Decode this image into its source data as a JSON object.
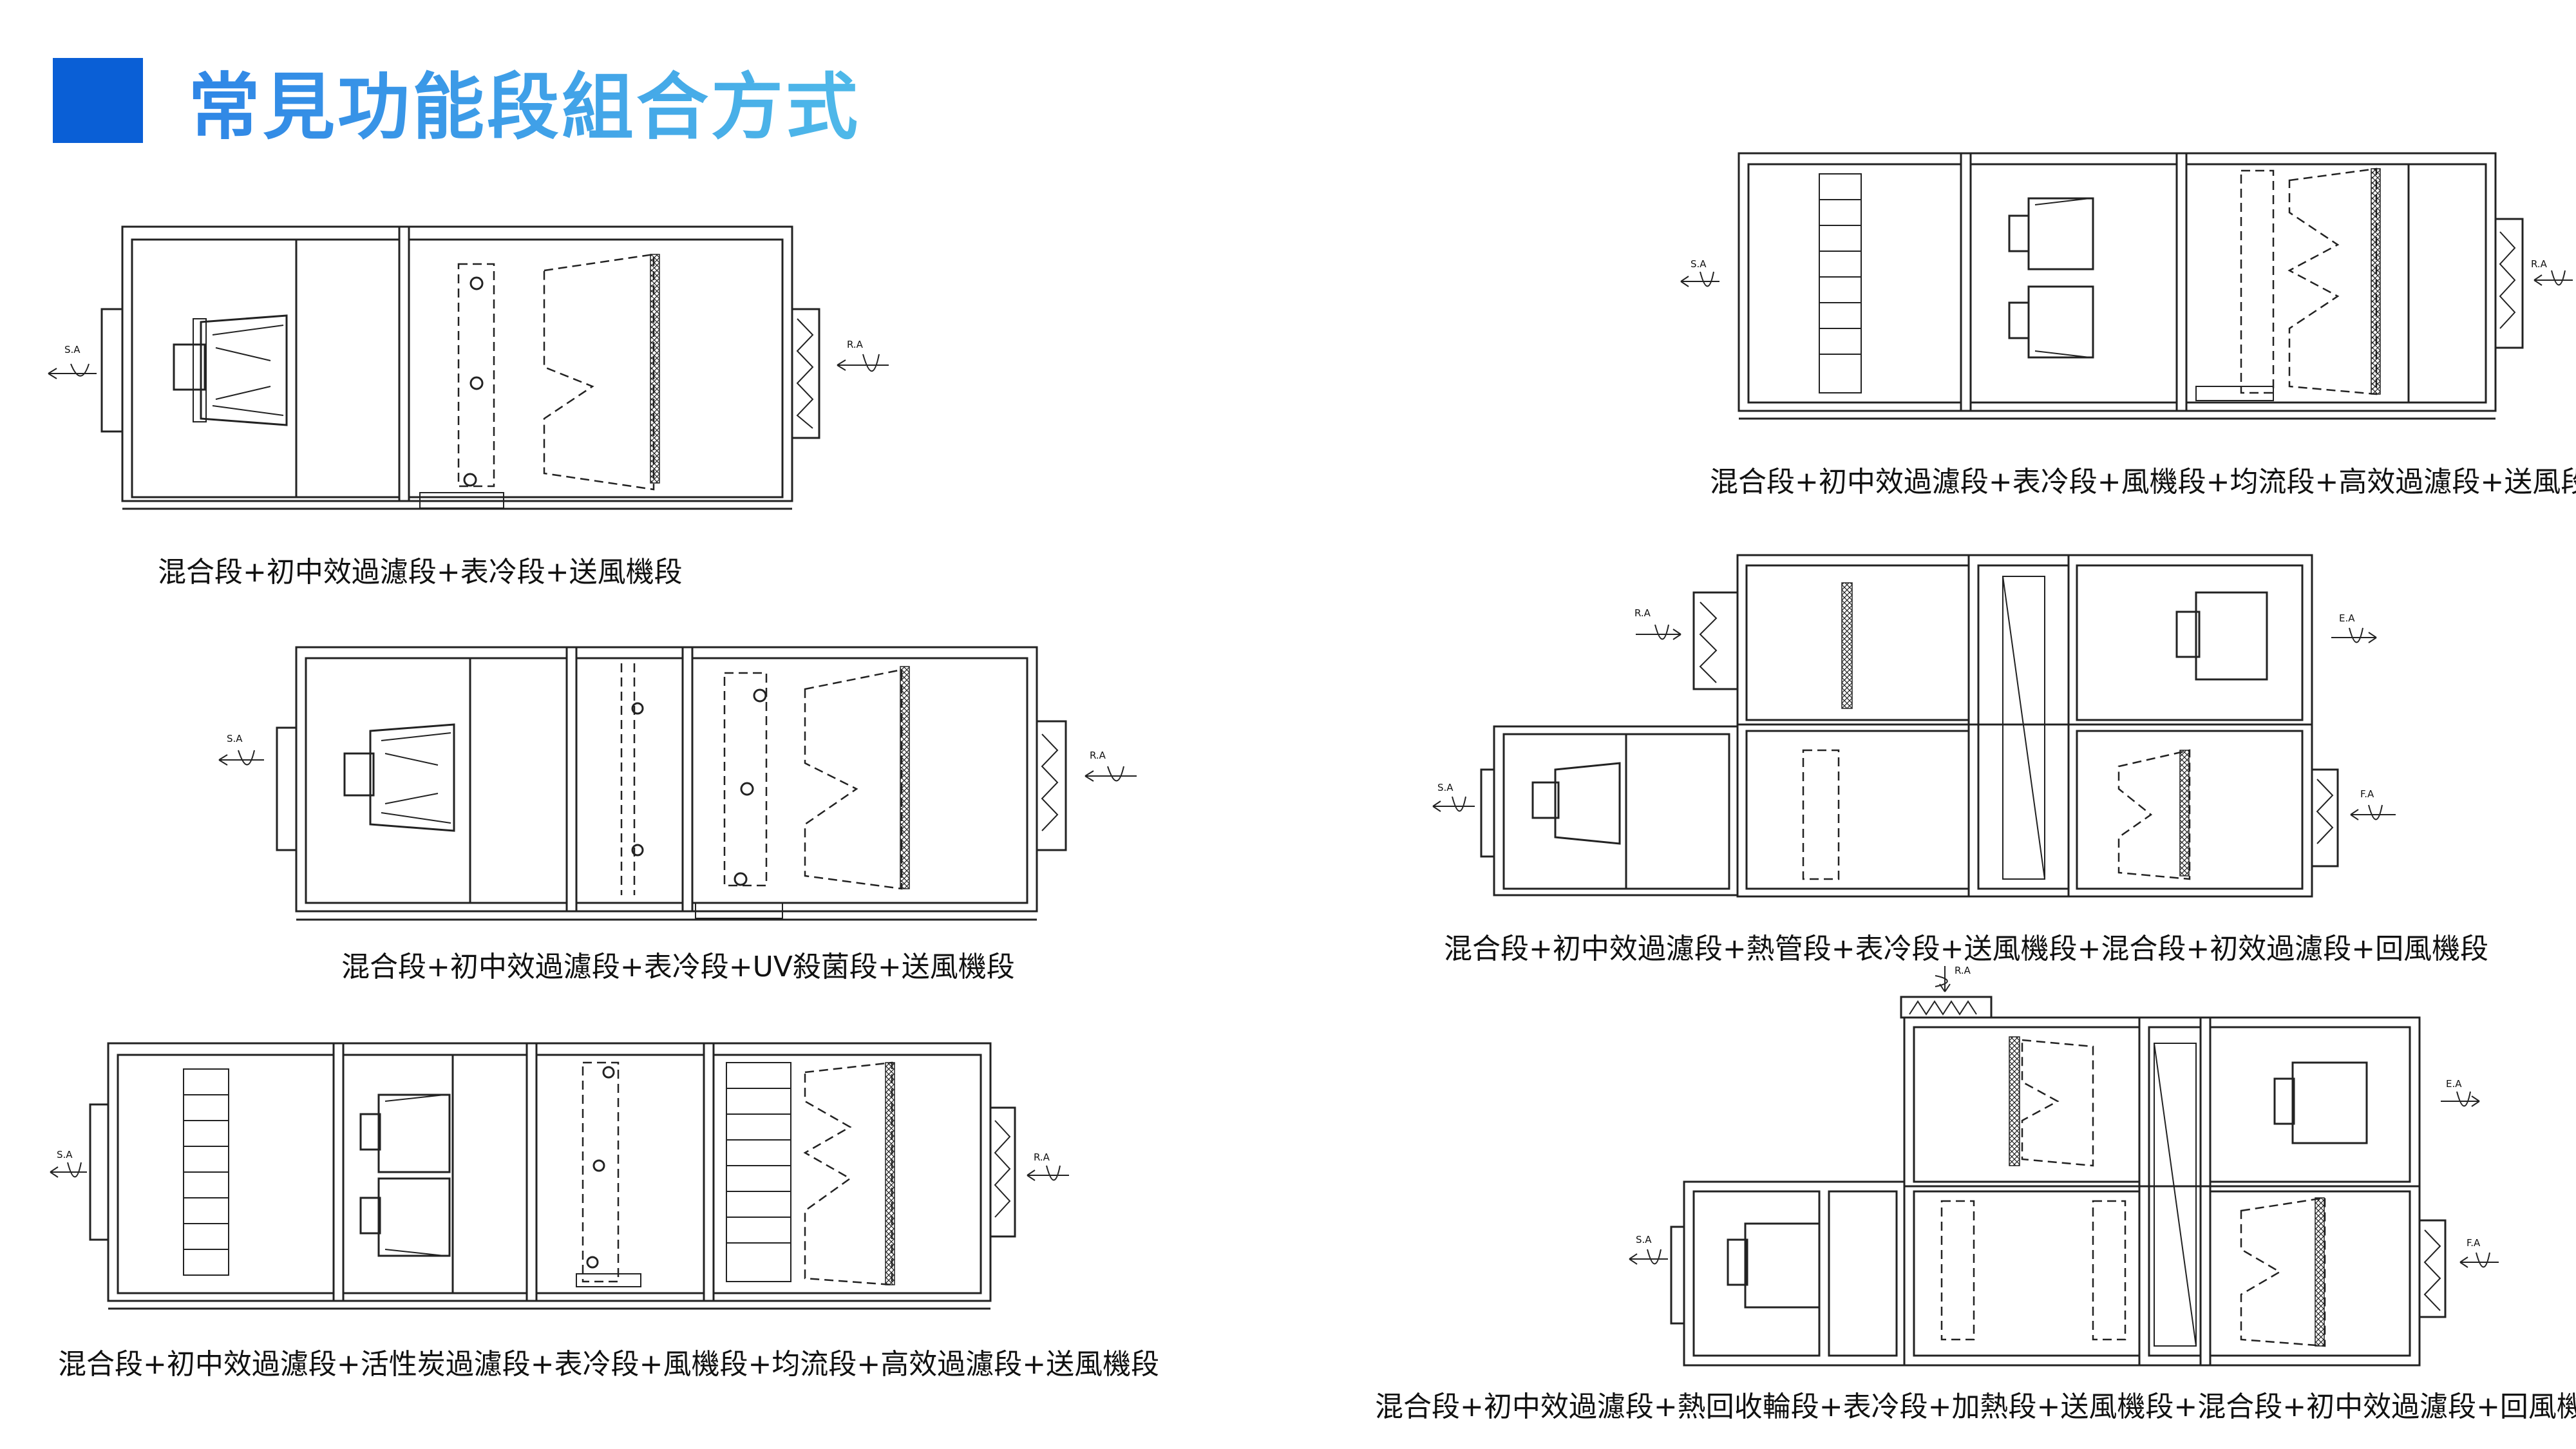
{
  "title": "常見功能段組合方式",
  "colors": {
    "title_block": "#0a5fd6",
    "title_gradient_start": "#2f86e6",
    "title_gradient_end": "#4fb9e9",
    "line": "#222222"
  },
  "captions": [
    "混合段+初中效過濾段+表冷段+送風機段",
    "混合段+初中效過濾段+表冷段+UV殺菌段+送風機段",
    "混合段+初中效過濾段+活性炭過濾段+表冷段+風機段+均流段+高效過濾段+送風機段",
    "混合段+初中效過濾段+表冷段+風機段+均流段+高效過濾段+送風段",
    "混合段+初中效過濾段+熱管段+表冷段+送風機段+混合段+初效過濾段+回風機段",
    "混合段+初中效過濾段+熱回收輪段+表冷段+加熱段+送風機段+混合段+初中效過濾段+回風機段"
  ],
  "airflow_labels": {
    "sa": "S.A",
    "ra": "R.A",
    "ea": "E.A",
    "fa": "F.A"
  }
}
